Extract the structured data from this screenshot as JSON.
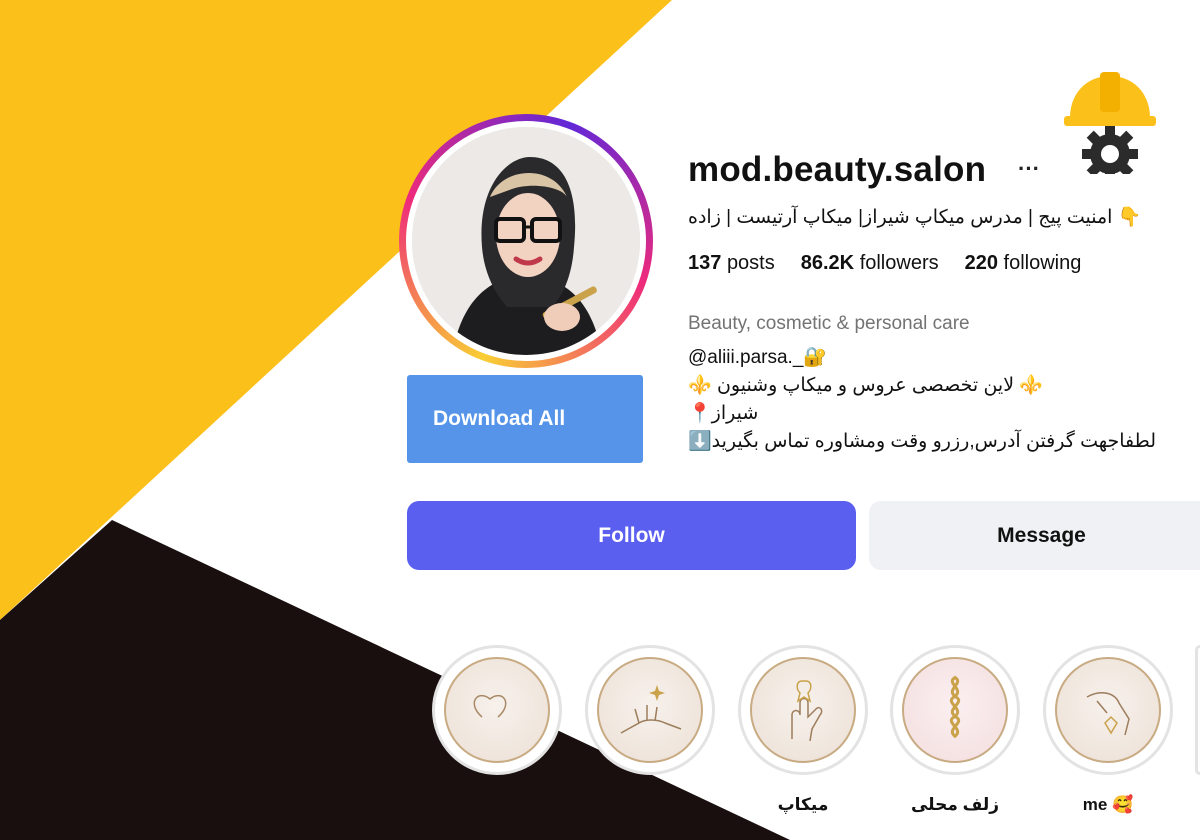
{
  "profile": {
    "username": "mod.beauty.salon",
    "more_icon": "···",
    "title_line": "👇 امنیت پیج | مدرس میکاپ شیراز| میکاپ آرتیست | زاده",
    "stats": {
      "posts_value": "137",
      "posts_label": "posts",
      "followers_value": "86.2K",
      "followers_label": "followers",
      "following_value": "220",
      "following_label": "following"
    },
    "category": "Beauty, cosmetic & personal care",
    "bio": [
      "@aliii.parsa._🔐",
      "⚜️ لاین تخصصی عروس و میکاپ وشنیون ⚜️",
      "📍شیراز",
      "⬇️لطفاجهت گرفتن آدرس,رزرو وقت ومشاوره تماس بگیرید"
    ]
  },
  "actions": {
    "download_all": "Download All",
    "follow": "Follow",
    "message": "Message"
  },
  "highlights": [
    {
      "label": "",
      "icon": "heart-outline-icon"
    },
    {
      "label": "",
      "icon": "hand-sparkle-icon"
    },
    {
      "label": "میکاپ",
      "icon": "hand-tooth-icon"
    },
    {
      "label": "زلف محلی",
      "icon": "hair-braid-icon"
    },
    {
      "label": "me 🥰",
      "icon": "hand-gem-icon"
    }
  ],
  "decor": {
    "logo_icon": "helmet-gear-icon",
    "colors": {
      "yellow": "#fcc01a",
      "dark": "#1a0f0f",
      "follow": "#5a5fef",
      "download": "#5594e9"
    }
  }
}
